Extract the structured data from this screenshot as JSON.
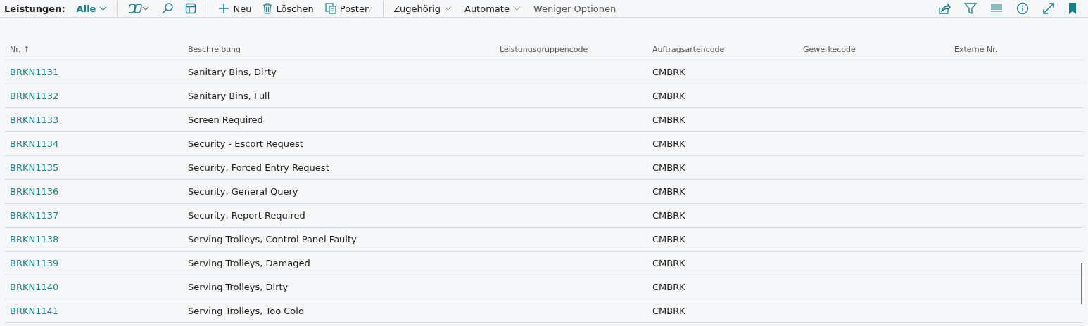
{
  "toolbar": {
    "title": "Leistungen:",
    "view": "Alle",
    "actions": [
      {
        "kind": "new",
        "label": "Neu"
      },
      {
        "kind": "delete",
        "label": "Löschen"
      },
      {
        "kind": "post",
        "label": "Posten"
      }
    ],
    "menus": [
      "Zugehörig",
      "Automate"
    ],
    "less_options": "Weniger Optionen"
  },
  "table": {
    "columns": [
      "Nr.",
      "Beschreibung",
      "Leistungsgruppencode",
      "Auftragsartencode",
      "Gewerkecode",
      "Externe Nr."
    ],
    "sort_indicator": "↑",
    "rows": [
      {
        "no": "BRKN1131",
        "description": "Sanitary Bins, Dirty",
        "order_type": "CMBRK"
      },
      {
        "no": "BRKN1132",
        "description": "Sanitary Bins, Full",
        "order_type": "CMBRK"
      },
      {
        "no": "BRKN1133",
        "description": "Screen Required",
        "order_type": "CMBRK"
      },
      {
        "no": "BRKN1134",
        "description": "Security - Escort Request",
        "order_type": "CMBRK"
      },
      {
        "no": "BRKN1135",
        "description": "Security, Forced Entry Request",
        "order_type": "CMBRK"
      },
      {
        "no": "BRKN1136",
        "description": "Security, General Query",
        "order_type": "CMBRK"
      },
      {
        "no": "BRKN1137",
        "description": "Security, Report Required",
        "order_type": "CMBRK"
      },
      {
        "no": "BRKN1138",
        "description": "Serving Trolleys, Control Panel Faulty",
        "order_type": "CMBRK"
      },
      {
        "no": "BRKN1139",
        "description": "Serving Trolleys, Damaged",
        "order_type": "CMBRK"
      },
      {
        "no": "BRKN1140",
        "description": "Serving Trolleys, Dirty",
        "order_type": "CMBRK"
      },
      {
        "no": "BRKN1141",
        "description": "Serving Trolleys, Too Cold",
        "order_type": "CMBRK"
      }
    ]
  }
}
